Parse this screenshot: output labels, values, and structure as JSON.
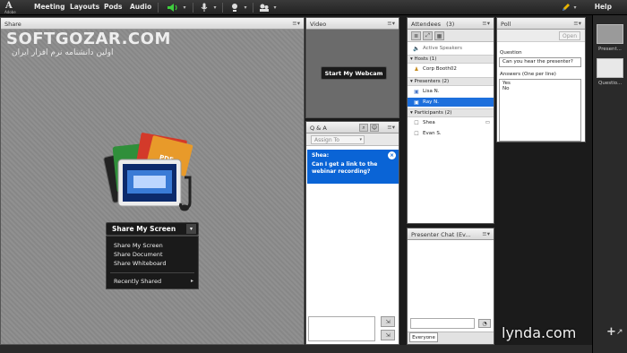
{
  "menubar": {
    "logo_letter": "A",
    "logo_sub": "Adobe",
    "items": [
      "Meeting",
      "Layouts",
      "Pods",
      "Audio"
    ],
    "help": "Help"
  },
  "share": {
    "title": "Share",
    "watermark": "SOFTGOZAR.COM",
    "watermark_sub": "اولین دانشنامه نرم افزار ایران",
    "button_label": "Share My Screen",
    "menu": [
      "Share My Screen",
      "Share Document",
      "Share Whiteboard"
    ],
    "recent": "Recently Shared"
  },
  "video": {
    "title": "Video",
    "button_label": "Start My Webcam"
  },
  "qa": {
    "title": "Q & A",
    "assign_placeholder": "Assign To",
    "question_author": "Shea:",
    "question_text": "Can I get a link to the webinar recording?"
  },
  "attendees": {
    "title": "Attendees",
    "count": "(3)",
    "active_speakers": "Active Speakers",
    "hosts_label": "Hosts (1)",
    "host": "Corp Booth02",
    "presenters_label": "Presenters (2)",
    "presenters": [
      "Lisa N.",
      "Ray N."
    ],
    "participants_label": "Participants (2)",
    "participants": [
      "Shea",
      "Evan S."
    ]
  },
  "presenter_chat": {
    "title": "Presenter Chat",
    "title_suffix": "(Ev...",
    "tab": "Everyone"
  },
  "poll": {
    "title": "Poll",
    "open_label": "Open",
    "question_label": "Question",
    "question_value": "Can you hear the presenter?",
    "answers_label": "Answers (One per line)",
    "answers": [
      "Yes",
      "No"
    ]
  },
  "sidebar": {
    "thumbs": [
      "Present...",
      "Questio..."
    ]
  },
  "branding": {
    "lynda": "lynda.com"
  },
  "colors": {
    "selection_blue": "#1d6fdc",
    "question_blue": "#0a64d6",
    "mic_green": "#3ecf3e"
  }
}
